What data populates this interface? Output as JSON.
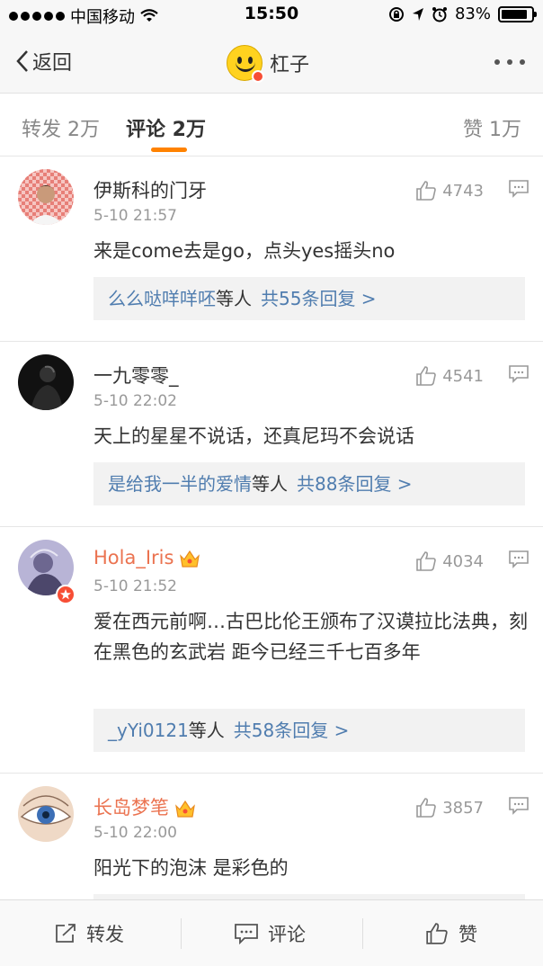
{
  "status": {
    "carrier": "中国移动",
    "time": "15:50",
    "battery": "83%"
  },
  "nav": {
    "back_label": "返回",
    "title": "杠子"
  },
  "tabs": [
    {
      "label": "转发 2万"
    },
    {
      "label": "评论 2万"
    },
    {
      "label": "赞 1万"
    }
  ],
  "comments": [
    {
      "user": "伊斯科的门牙",
      "time": "5-10 21:57",
      "likes": "4743",
      "text": "来是come去是go，点头yes摇头no",
      "reply_users": "么么哒咩咩呸",
      "reply_suffix": "等人",
      "reply_count": "共55条回复 >"
    },
    {
      "user": "一九零零_",
      "time": "5-10 22:02",
      "likes": "4541",
      "text": "天上的星星不说话，还真尼玛不会说话",
      "reply_users": "是给我一半的爱情",
      "reply_suffix": "等人",
      "reply_count": "共88条回复 >"
    },
    {
      "user": "Hola_Iris",
      "time": "5-10 21:52",
      "likes": "4034",
      "text": "爱在西元前啊…古巴比伦王颁布了汉谟拉比法典，刻在黑色的玄武岩 距今已经三千七百多年",
      "reply_users": "_yYi0121",
      "reply_suffix": "等人",
      "reply_count": "共58条回复 >"
    },
    {
      "user": "长岛梦笔",
      "time": "5-10 22:00",
      "likes": "3857",
      "text": "阳光下的泡沫 是彩色的"
    }
  ],
  "toolbar": {
    "repost": "转发",
    "comment": "评论",
    "like": "赞"
  },
  "colors": {
    "accent": "#ff8200",
    "link": "#507daf",
    "vip_name": "#eb7350"
  }
}
